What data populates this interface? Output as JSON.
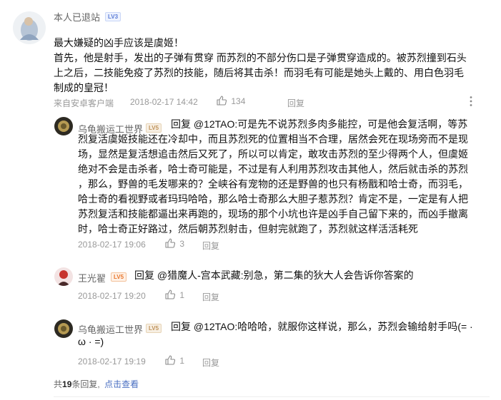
{
  "top_comment": {
    "user": "本人已退站",
    "level": "LV3",
    "lines": [
      "最大嫌疑的凶手应该是虞姬！",
      "首先，他是射手，发出的子弹有贯穿 而苏烈的不部分伤口是子弹贯穿造成的。被苏烈撞到石头",
      "上之后，二技能免疫了苏烈的技能，随后将其击杀！而羽毛有可能是她头上戴的、用白色羽毛",
      "制成的皇冠！"
    ],
    "source": "来自安卓客户端",
    "time": "2018-02-17 14:42",
    "likes": "134",
    "reply_label": "回复"
  },
  "replies": [
    {
      "user": "乌龟搬运工世界",
      "level": "LV5",
      "lines": [
        "回复 @12TAO:可是先不说苏烈多肉多能控，可是他会复活啊，等苏",
        "烈复活虞姬技能还在冷却中，而且苏烈死的位置相当不合理，居然会死在现场旁而不是现",
        "场，显然是复活想追击然后又死了，所以可以肯定，敢攻击苏烈的至少得两个人，但虞姬",
        "绝对不会是击杀者，哈士奇可能是，不过是有人利用苏烈攻击其他人，然后就击杀的苏烈",
        "，那么，野兽的毛发哪来的？全峡谷有宠物的还是野兽的也只有杨戬和哈士奇，而羽毛，",
        "哈士奇的看视野或者玛玛哈哈，那么哈士奇那么大胆子惹苏烈？肯定不是，一定是有人把",
        "苏烈复活和技能都逼出来再跑的，现场的那个小坑也许是凶手自己留下来的，而凶手撤离",
        "时，哈士奇正好路过，然后朝苏烈射击，但射完就跑了，苏烈就这样活活耗死"
      ],
      "time": "2018-02-17 19:06",
      "likes": "3",
      "reply_label": "回复"
    },
    {
      "user": "王光翟",
      "level": "LV5",
      "lines": [
        "回复 @猎魔人-宫本武藏:别急，第二集的狄大人会告诉你答案的"
      ],
      "time": "2018-02-17 19:20",
      "likes": "1",
      "reply_label": "回复"
    },
    {
      "user": "乌龟搬运工世界",
      "level": "LV5",
      "lines": [
        "回复 @12TAO:哈哈哈，就服你这样说，那么，苏烈会输给射手吗(= ·",
        "ω · =)"
      ],
      "time": "2018-02-17 19:19",
      "likes": "1",
      "reply_label": "回复"
    }
  ],
  "footer": {
    "prefix": "共",
    "count": "19",
    "suffix": "条回复,",
    "link": "点击查看"
  },
  "colors": {
    "link": "#4a6fc2",
    "meta": "#999999",
    "level_blue": "#5b7cd6",
    "level_orange": "#e8772e"
  },
  "icons": [
    "thumb-up-icon",
    "more-vertical-icon"
  ]
}
